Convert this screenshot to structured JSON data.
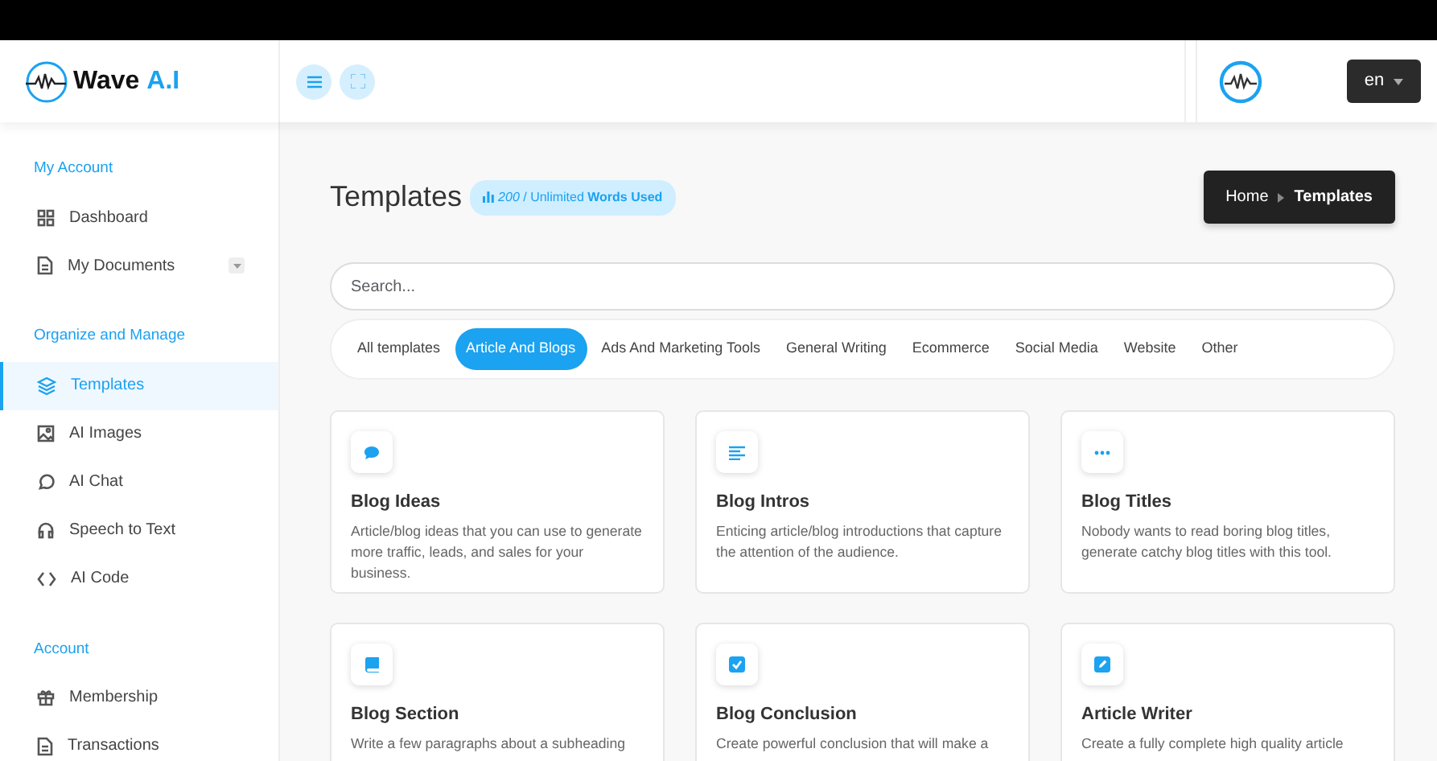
{
  "brand": {
    "name": "Wave ",
    "accent": "A.I"
  },
  "header": {
    "language": "en"
  },
  "sidebar": {
    "sections": [
      {
        "title": "My Account",
        "items": [
          {
            "label": "Dashboard",
            "selected": false,
            "dropdown": false
          },
          {
            "label": "My Documents",
            "selected": false,
            "dropdown": true
          }
        ]
      },
      {
        "title": "Organize and Manage",
        "items": [
          {
            "label": "Templates",
            "selected": true,
            "dropdown": false
          },
          {
            "label": "AI Images",
            "selected": false,
            "dropdown": false
          },
          {
            "label": "AI Chat",
            "selected": false,
            "dropdown": false
          },
          {
            "label": "Speech to Text",
            "selected": false,
            "dropdown": false
          },
          {
            "label": "AI Code",
            "selected": false,
            "dropdown": false
          }
        ]
      },
      {
        "title": "Account",
        "items": [
          {
            "label": "Membership",
            "selected": false,
            "dropdown": false
          },
          {
            "label": "Transactions",
            "selected": false,
            "dropdown": false
          }
        ]
      }
    ]
  },
  "page": {
    "title": "Templates",
    "usage": "*200* / Unlimited **Words Used**",
    "breadcrumb": [
      "Home",
      "Templates"
    ]
  },
  "search": {
    "placeholder": "Search..."
  },
  "filters": [
    {
      "label": "All templates",
      "selected": false
    },
    {
      "label": "Article And Blogs",
      "selected": true
    },
    {
      "label": "Ads And Marketing Tools",
      "selected": false
    },
    {
      "label": "General Writing",
      "selected": false
    },
    {
      "label": "Ecommerce",
      "selected": false
    },
    {
      "label": "Social Media",
      "selected": false
    },
    {
      "label": "Website",
      "selected": false
    },
    {
      "label": "Other",
      "selected": false
    }
  ],
  "templates": [
    {
      "title": "Blog Ideas",
      "description": "Article/blog ideas that you can use to generate more traffic, leads, and sales for your business."
    },
    {
      "title": "Blog Intros",
      "description": "Enticing article/blog introductions that capture the attention of the audience."
    },
    {
      "title": "Blog Titles",
      "description": "Nobody wants to read boring blog titles, generate catchy blog titles with this tool."
    },
    {
      "title": "Blog Section",
      "description": "Write a few paragraphs about a subheading"
    },
    {
      "title": "Blog Conclusion",
      "description": "Create powerful conclusion that will make a"
    },
    {
      "title": "Article Writer",
      "description": "Create a fully complete high quality article"
    }
  ]
}
